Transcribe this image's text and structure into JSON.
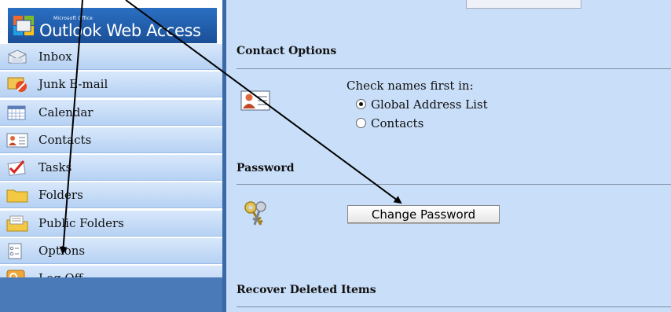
{
  "app": {
    "brand_small": "Microsoft Office",
    "brand_title": "Outlook Web Access"
  },
  "sidebar": {
    "items": [
      {
        "label": "Inbox",
        "icon": "inbox-icon"
      },
      {
        "label": "Junk E-mail",
        "icon": "junk-email-icon"
      },
      {
        "label": "Calendar",
        "icon": "calendar-icon"
      },
      {
        "label": "Contacts",
        "icon": "contacts-icon"
      },
      {
        "label": "Tasks",
        "icon": "tasks-icon"
      },
      {
        "label": "Folders",
        "icon": "folder-icon"
      },
      {
        "label": "Public Folders",
        "icon": "public-folders-icon"
      },
      {
        "label": "Options",
        "icon": "options-icon"
      },
      {
        "label": "Log Off",
        "icon": "log-off-icon"
      }
    ]
  },
  "main": {
    "contact_options": {
      "title": "Contact Options",
      "check_label": "Check names first in:",
      "radio_options": [
        {
          "label": "Global Address List",
          "selected": true
        },
        {
          "label": "Contacts",
          "selected": false
        }
      ]
    },
    "password": {
      "title": "Password",
      "button_label": "Change Password"
    },
    "recover": {
      "title": "Recover Deleted Items"
    }
  },
  "colors": {
    "panel_bg": "#c9def8",
    "sidebar_accent": "#3b69a8",
    "nav_item_bg": "#c6dcf6",
    "annotation_arrow": "#000000"
  }
}
